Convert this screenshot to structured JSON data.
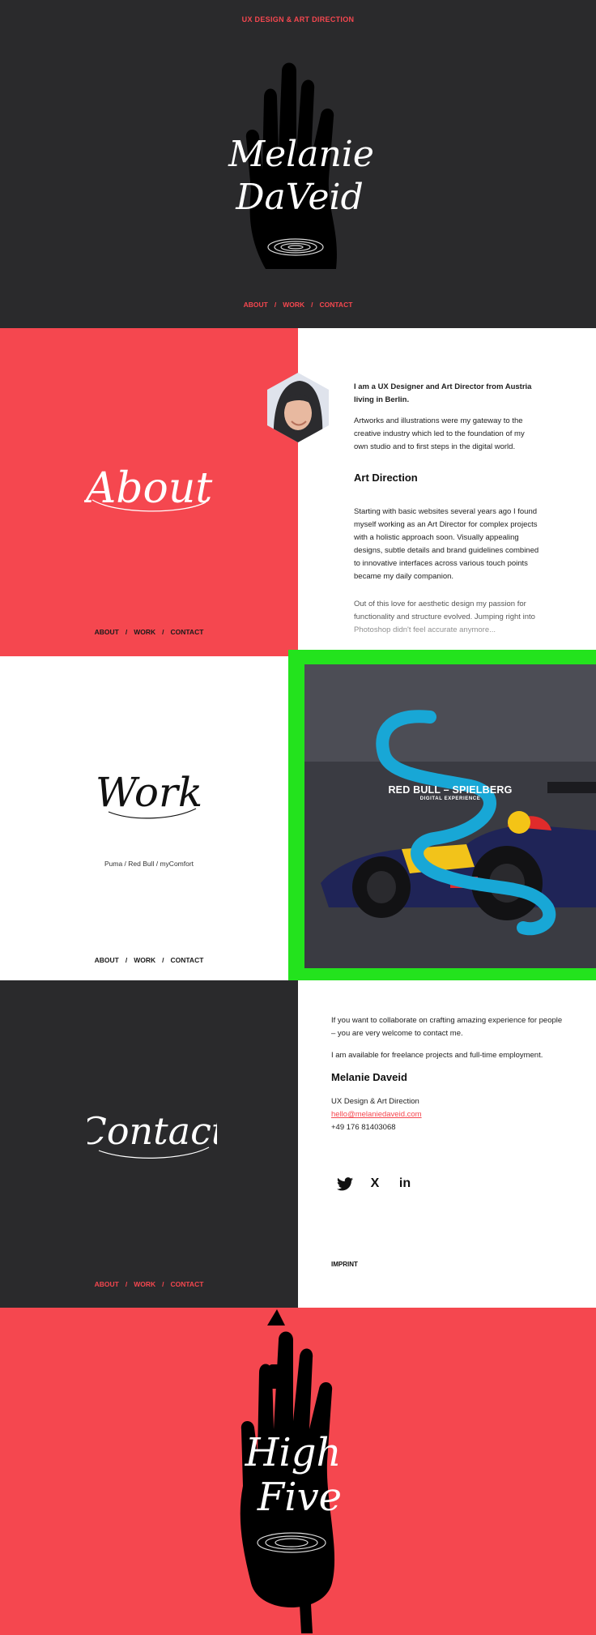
{
  "hero": {
    "tagline": "UX DESIGN & ART DIRECTION",
    "name_line1": "Melanie",
    "name_line2": "DaVeid",
    "nav": [
      "ABOUT",
      "WORK",
      "CONTACT"
    ],
    "nav_sep": "/"
  },
  "about": {
    "script_title": "About",
    "nav": [
      "ABOUT",
      "WORK",
      "CONTACT"
    ],
    "lead": "I am a UX Designer and Art Director from Austria living in Berlin.",
    "p1": "Artworks and illustrations were my gateway to the creative industry which led to the foundation of my own studio and to first steps in the digital world.",
    "heading": "Art Direction",
    "p2": "Starting with basic websites several years ago I found myself working as an Art Director for complex projects with a holistic approach soon. Visually appealing designs, subtle details and brand guidelines combined to innovative interfaces across various touch points became my daily companion.",
    "p3": "Out of this love for aesthetic design my passion for functionality and structure evolved. Jumping right into Photoshop didn't feel accurate anymore..."
  },
  "work": {
    "script_title": "Work",
    "subtitle": "Puma / Red Bull / myComfort",
    "nav": [
      "ABOUT",
      "WORK",
      "CONTACT"
    ],
    "project_title": "RED BULL – SPIELBERG",
    "project_tag": "DIGITAL EXPERIENCE"
  },
  "contact": {
    "script_title": "Contact",
    "nav": [
      "ABOUT",
      "WORK",
      "CONTACT"
    ],
    "intro": "If you want to collaborate on crafting amazing experience for people – you are very welcome to contact me.",
    "availability": "I am available for freelance projects and full-time employment.",
    "name": "Melanie Daveid",
    "role": "UX Design & Art Direction",
    "email": "hello@melaniedaveid.com",
    "phone": "+49 176 81403068",
    "social": [
      "twitter-icon",
      "xing-icon",
      "linkedin-icon"
    ],
    "social_glyphs": [
      "",
      "X",
      "in"
    ],
    "imprint": "IMPRINT"
  },
  "footer": {
    "script_line1": "High",
    "script_line2": "Five"
  },
  "colors": {
    "accent": "#f5474f",
    "dark": "#2a2a2c",
    "annotation_green": "#23e31d",
    "annotation_blue": "#18a7d6"
  }
}
